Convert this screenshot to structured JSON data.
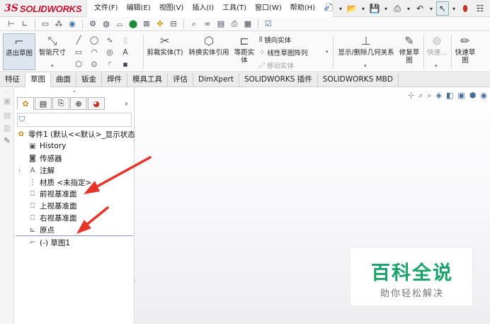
{
  "app": {
    "logo_ds": "3S",
    "logo_name": "SOLIDWORKS"
  },
  "menu": [
    "文件(F)",
    "编辑(E)",
    "视图(V)",
    "插入(I)",
    "工具(T)",
    "窗口(W)",
    "帮助(H)"
  ],
  "ribbon": {
    "exit_sketch": "退出草图",
    "smart_dimension": "智能尺寸",
    "trim_entities": "剪裁实体(T)",
    "convert_entities": "转换实体引用",
    "offset_entities_line1": "等距实",
    "offset_entities_line2": "体",
    "mirror_entities": "镜向实体",
    "linear_pattern": "线性草图阵列",
    "move_entities": "移动实体",
    "display_relations": "显示/删除几何关系",
    "repair_sketch_line1": "修复草",
    "repair_sketch_line2": "图",
    "quick_snaps": "快速...",
    "rapid_sketch_line1": "快速草",
    "rapid_sketch_line2": "图"
  },
  "tabs": [
    {
      "label": "特征",
      "active": false
    },
    {
      "label": "草图",
      "active": true
    },
    {
      "label": "曲面",
      "active": false
    },
    {
      "label": "钣金",
      "active": false
    },
    {
      "label": "焊件",
      "active": false
    },
    {
      "label": "模具工具",
      "active": false
    },
    {
      "label": "评估",
      "active": false
    },
    {
      "label": "DimXpert",
      "active": false
    },
    {
      "label": "SOLIDWORKS 插件",
      "active": false
    },
    {
      "label": "SOLIDWORKS MBD",
      "active": false
    }
  ],
  "tree": {
    "part": "零件1 (默认<<默认>_显示状态",
    "history": "History",
    "sensors": "传感器",
    "annotations": "注解",
    "material": "材质 <未指定>",
    "front_plane": "前视基准面",
    "top_plane": "上视基准面",
    "right_plane": "右视基准面",
    "origin": "原点",
    "sketch": "(-) 草图1"
  },
  "watermark": {
    "title": "百科全说",
    "subtitle": "助你轻松解决"
  },
  "colors": {
    "arrow": "#e8332a",
    "brand": "#c8102e",
    "watermark": "#1aa36a"
  }
}
